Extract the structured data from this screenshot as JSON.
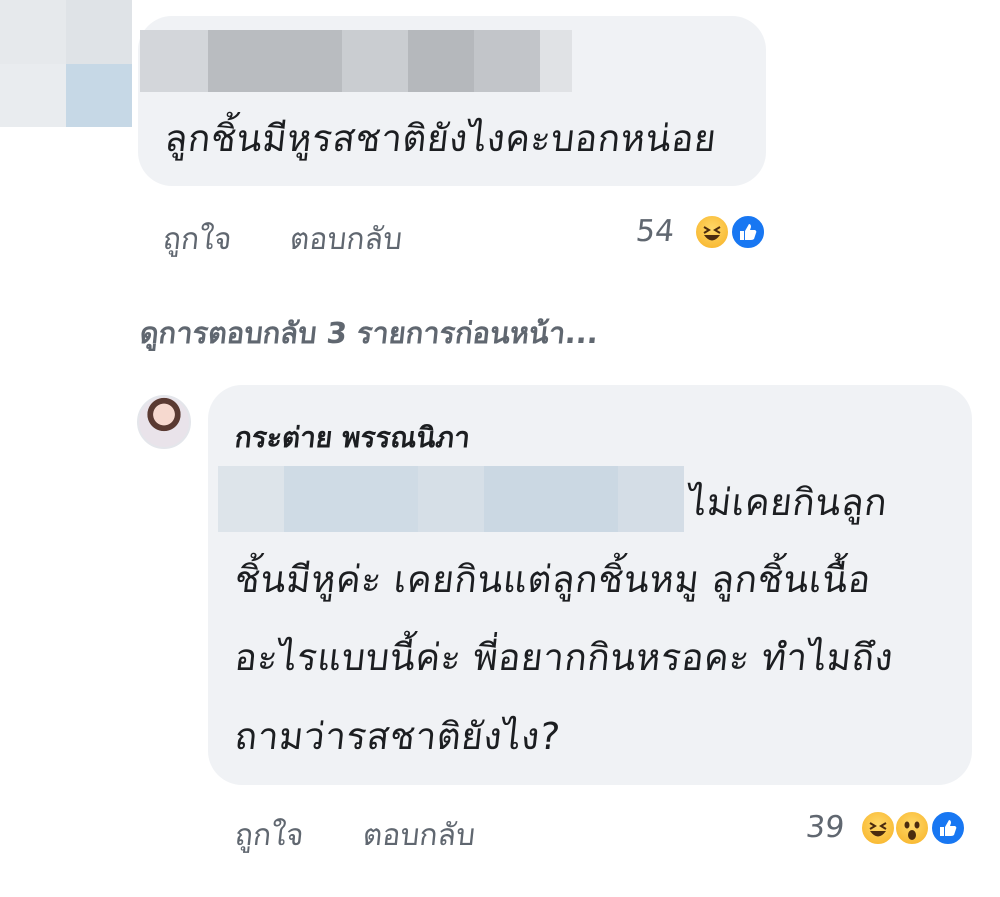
{
  "comments": [
    {
      "text": "ลูกชิ้นมีหูรสชาติยังไงคะบอกหน่อย",
      "actions": {
        "like": "ถูกใจ",
        "reply": "ตอบกลับ"
      },
      "reaction_count": "54",
      "reactions": [
        "haha-icon",
        "like-icon"
      ]
    },
    {
      "author": "กระต่าย พรรณนิภา",
      "lines": [
        "ไม่เคยกินลูก",
        "ชิ้นมีหูค่ะ เคยกินแต่ลูกชิ้นหมู ลูกชิ้นเนื้อ",
        "อะไรแบบนี้ค่ะ พี่อยากกินหรอคะ ทำไมถึง",
        "ถามว่ารสชาติยังไง?"
      ],
      "actions": {
        "like": "ถูกใจ",
        "reply": "ตอบกลับ"
      },
      "reaction_count": "39",
      "reactions": [
        "haha-icon",
        "wow-icon",
        "like-icon"
      ]
    }
  ],
  "view_previous_replies": "ดูการตอบกลับ 3 รายการก่อนหน้า...",
  "colors": {
    "bubble": "#f0f2f5",
    "muted_text": "#606770",
    "like_blue": "#1877f2",
    "haha_yellow": "#f7b125"
  }
}
